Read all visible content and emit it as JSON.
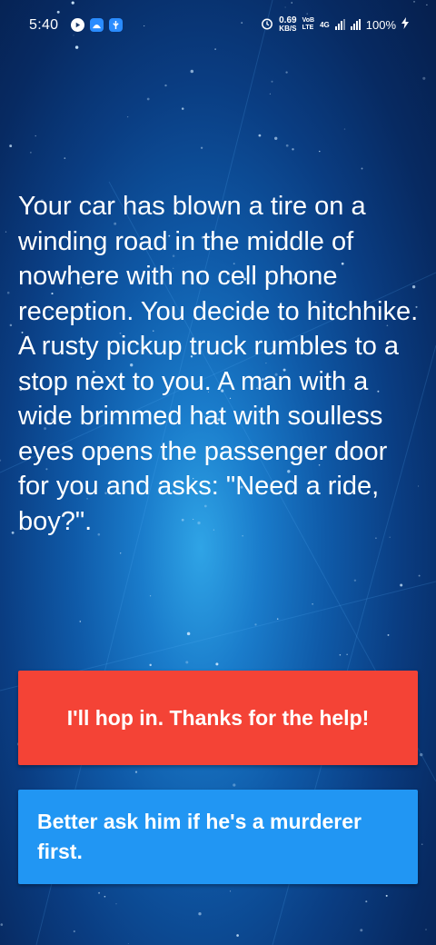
{
  "status_bar": {
    "time": "5:40",
    "net_speed_value": "0.69",
    "net_speed_unit": "KB/S",
    "volte_top": "VoB",
    "volte_bottom": "LTE",
    "network_type": "4G",
    "battery": "100%"
  },
  "story": {
    "text": "Your car has blown a tire on a winding road in the middle of nowhere with no cell phone reception. You decide to hitchhike. A rusty pickup truck rumbles to a stop next to you. A man with a wide brimmed hat with soulless eyes opens the passenger door for you and asks: \"Need a ride, boy?\"."
  },
  "choices": [
    {
      "label": "I'll hop in. Thanks for the help!",
      "color": "#f44336"
    },
    {
      "label": "Better ask him if he's a murderer first.",
      "color": "#2196f3"
    }
  ],
  "theme": {
    "background": "#0a3d82",
    "text": "#ffffff"
  }
}
